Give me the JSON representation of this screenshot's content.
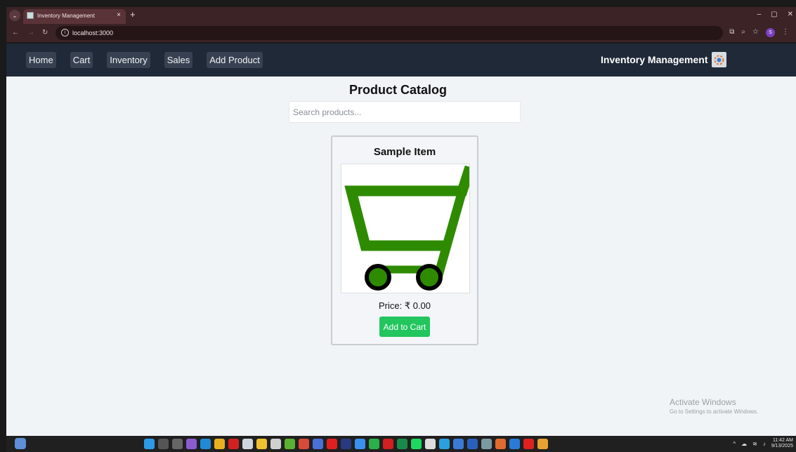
{
  "browser": {
    "tab_title": "Inventory Management",
    "tab_close": "×",
    "new_tab": "+",
    "url": "localhost:3000",
    "window_controls": [
      "–",
      "▢",
      "✕"
    ],
    "profile_initial": "S"
  },
  "navbar": {
    "links": [
      "Home",
      "Cart",
      "Inventory",
      "Sales",
      "Add Product"
    ],
    "brand": "Inventory Management"
  },
  "page": {
    "title": "Product Catalog",
    "search_placeholder": "Search products..."
  },
  "product": {
    "name": "Sample Item",
    "price_label": "Price: ₹ 0.00",
    "button_label": "Add to Cart",
    "cart_color": "#2e8b00"
  },
  "watermark": {
    "title": "Activate Windows",
    "subtitle": "Go to Settings to activate Windows."
  },
  "taskbar": {
    "time": "11:42 AM",
    "date": "9/13/2025"
  }
}
